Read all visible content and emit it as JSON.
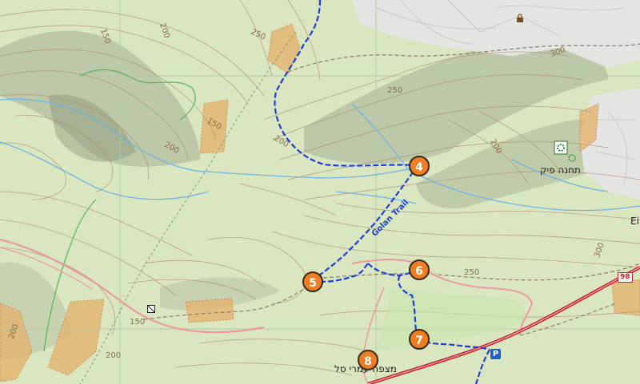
{
  "map": {
    "colors": {
      "background": "#d9e6c0",
      "contour": "#b08a68",
      "stream": "#6fb4e0",
      "trail": "#1f3fd1",
      "highway": "#c81e2a",
      "road": "#e89aa0",
      "path": "#8c7a6a",
      "marker": "#ef7d22",
      "shade": "#9aa08a",
      "orchard": "#e3b46e",
      "urban": "#e2e2e2"
    },
    "trail_name": "Golan Trail",
    "place_labels": {
      "station_peak": "תחנה פיק",
      "viewpoint": "מצפה עמרי סל",
      "edge_ein": "Ei"
    },
    "road_number": "98",
    "parking_symbol": "P",
    "markers": [
      "4",
      "5",
      "6",
      "7",
      "8"
    ],
    "contour_labels": [
      "250",
      "200",
      "150",
      "250",
      "300",
      "200",
      "150",
      "200",
      "200",
      "250",
      "300",
      "150",
      "200",
      "200"
    ],
    "icons": [
      "park-icon",
      "viewpoint-icon",
      "parking-icon",
      "lock-icon"
    ]
  }
}
